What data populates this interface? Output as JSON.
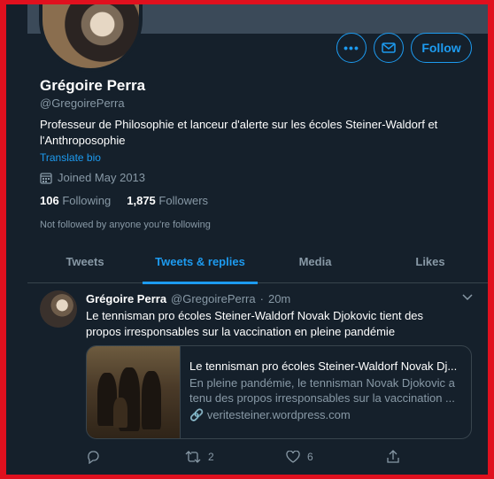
{
  "profile": {
    "name": "Grégoire Perra",
    "handle": "@GregoirePerra",
    "bio": "Professeur de Philosophie et lanceur d'alerte sur les écoles Steiner-Waldorf et l'Anthroposophie",
    "translate_label": "Translate bio",
    "joined": "Joined May 2013",
    "following_count": "106",
    "following_label": "Following",
    "followers_count": "1,875",
    "followers_label": "Followers",
    "not_followed": "Not followed by anyone you're following"
  },
  "actions": {
    "follow_label": "Follow",
    "more_icon": "more-icon",
    "message_icon": "envelope-icon"
  },
  "tabs": [
    {
      "label": "Tweets"
    },
    {
      "label": "Tweets & replies"
    },
    {
      "label": "Media"
    },
    {
      "label": "Likes"
    }
  ],
  "active_tab": "Tweets & replies",
  "tweet": {
    "author": "Grégoire Perra",
    "handle": "@GregoirePerra",
    "separator": "·",
    "time": "20m",
    "text": "Le tennisman pro écoles Steiner-Waldorf Novak Djokovic tient des propos irresponsables sur la vaccination en pleine pandémie",
    "card": {
      "title": "Le tennisman pro écoles Steiner-Waldorf Novak Dj...",
      "description": "En pleine pandémie, le tennisman Novak Djokovic a tenu des propos irresponsables sur la vaccination ...",
      "url": "veritesteiner.wordpress.com"
    },
    "replies": "",
    "retweets": "2",
    "likes": "6"
  },
  "colors": {
    "background": "#15202b",
    "accent": "#1d9bf0",
    "secondary_text": "#8899a6",
    "border": "#38444d",
    "frame": "#e0101e"
  }
}
